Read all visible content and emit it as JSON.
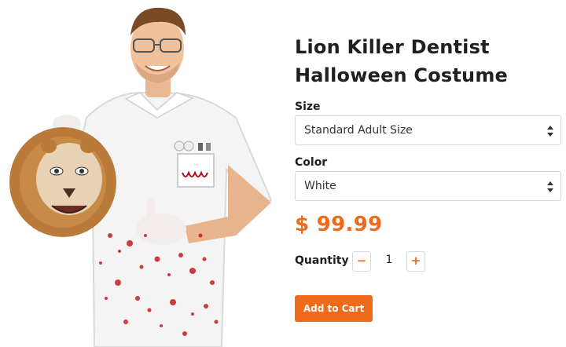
{
  "product": {
    "title": "Lion Killer Dentist Halloween Costume",
    "price": "$ 99.99",
    "image_alt": "Man in blood-spattered white dentist coat holding a lion head mask"
  },
  "options": {
    "size_label": "Size",
    "size_value": "Standard Adult Size",
    "color_label": "Color",
    "color_value": "White"
  },
  "quantity": {
    "label": "Quantity",
    "value": "1",
    "decrement": "−",
    "increment": "+"
  },
  "actions": {
    "add_to_cart": "Add to Cart"
  },
  "colors": {
    "accent": "#ef6a1a",
    "border": "#d6d6d6"
  }
}
